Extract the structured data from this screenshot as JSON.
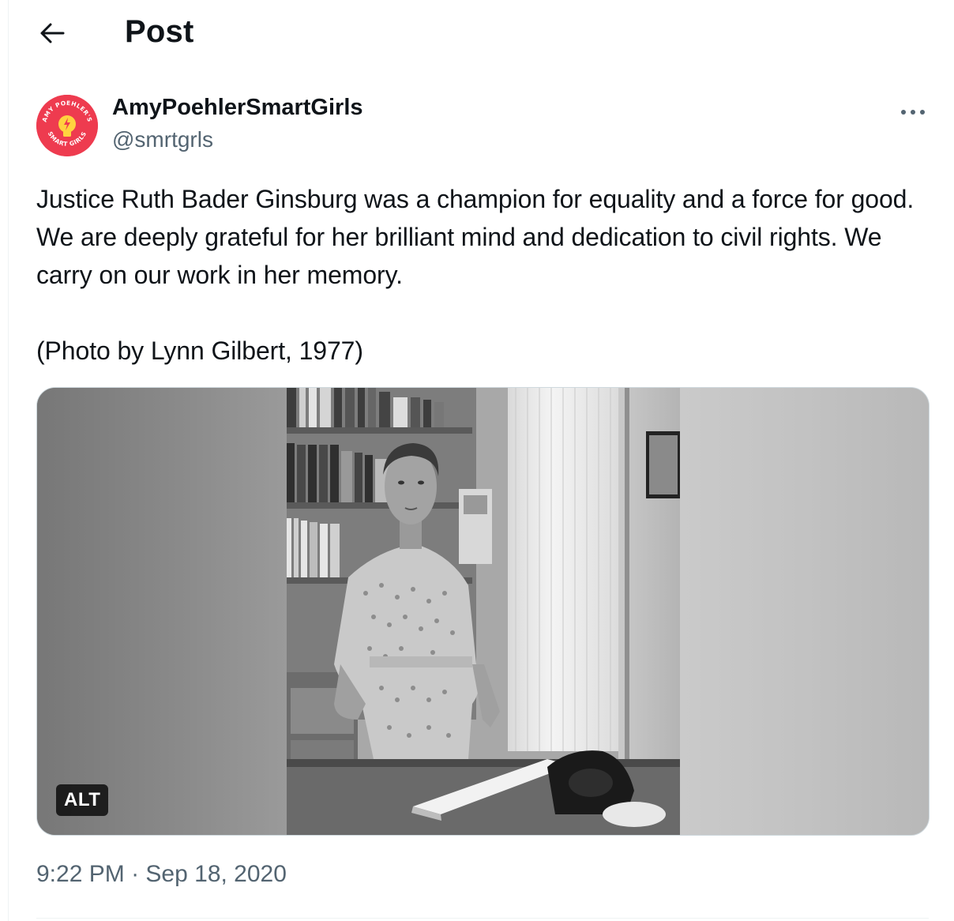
{
  "header": {
    "back_icon": "arrow-left-icon",
    "title": "Post"
  },
  "author": {
    "display_name": "AmyPoehlerSmartGirls",
    "handle": "@smrtgrls",
    "avatar_text_top": "AMY POEHLER'S",
    "avatar_text_bottom": "SMART GIRLS",
    "avatar_color": "#ee3b4f",
    "more_icon": "more-horizontal-icon"
  },
  "tweet": {
    "text_line_1": "Justice Ruth Bader Ginsburg was a champion for equality and a force for good. We are deeply grateful for her brilliant mind and dedication to civil rights. We carry on our work in her memory.",
    "text_line_2": "(Photo by Lynn Gilbert, 1977)",
    "alt_badge": "ALT",
    "time": "9:22 PM",
    "separator": "·",
    "date": "Sep 18, 2020"
  },
  "colors": {
    "text_primary": "#0f1419",
    "text_secondary": "#536471",
    "border": "#cfd9de"
  }
}
